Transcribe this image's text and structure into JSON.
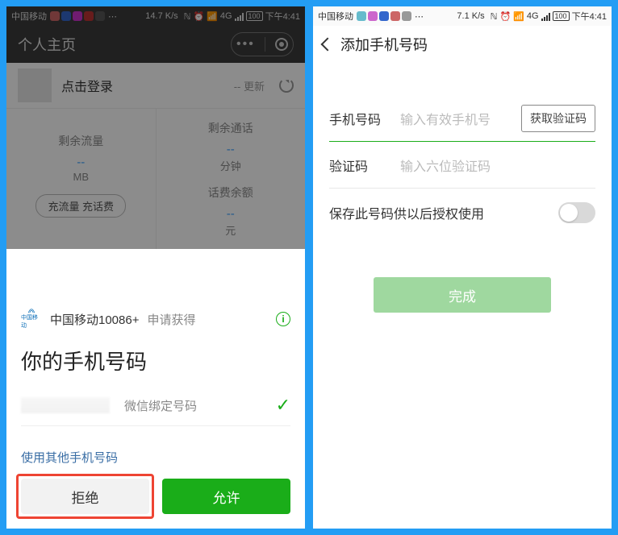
{
  "left": {
    "status": {
      "carrier": "中国移动",
      "speed": "14.7 K/s",
      "net": "4G",
      "battery": "100",
      "time": "下午4:41"
    },
    "titlebar": {
      "title": "个人主页"
    },
    "user": {
      "login_text": "点击登录",
      "update": "-- 更新"
    },
    "stats": {
      "traffic_label": "剩余流量",
      "traffic_val": "--",
      "traffic_unit": "MB",
      "call_label": "剩余通话",
      "call_val": "--",
      "call_unit": "分钟",
      "balance_label": "话费余额",
      "balance_val": "--",
      "balance_unit": "元",
      "recharge": "充流量 充话费"
    },
    "sheet": {
      "app_name": "中国移动10086+",
      "request": "申请获得",
      "title": "你的手机号码",
      "phone_desc": "微信绑定号码",
      "other": "使用其他手机号码",
      "deny": "拒绝",
      "allow": "允许"
    }
  },
  "right": {
    "status": {
      "carrier": "中国移动",
      "speed": "7.1 K/s",
      "net": "4G",
      "battery": "100",
      "time": "下午4:41"
    },
    "title": "添加手机号码",
    "phone_label": "手机号码",
    "phone_ph": "输入有效手机号",
    "getcode": "获取验证码",
    "code_label": "验证码",
    "code_ph": "输入六位验证码",
    "save_text": "保存此号码供以后授权使用",
    "done": "完成"
  }
}
